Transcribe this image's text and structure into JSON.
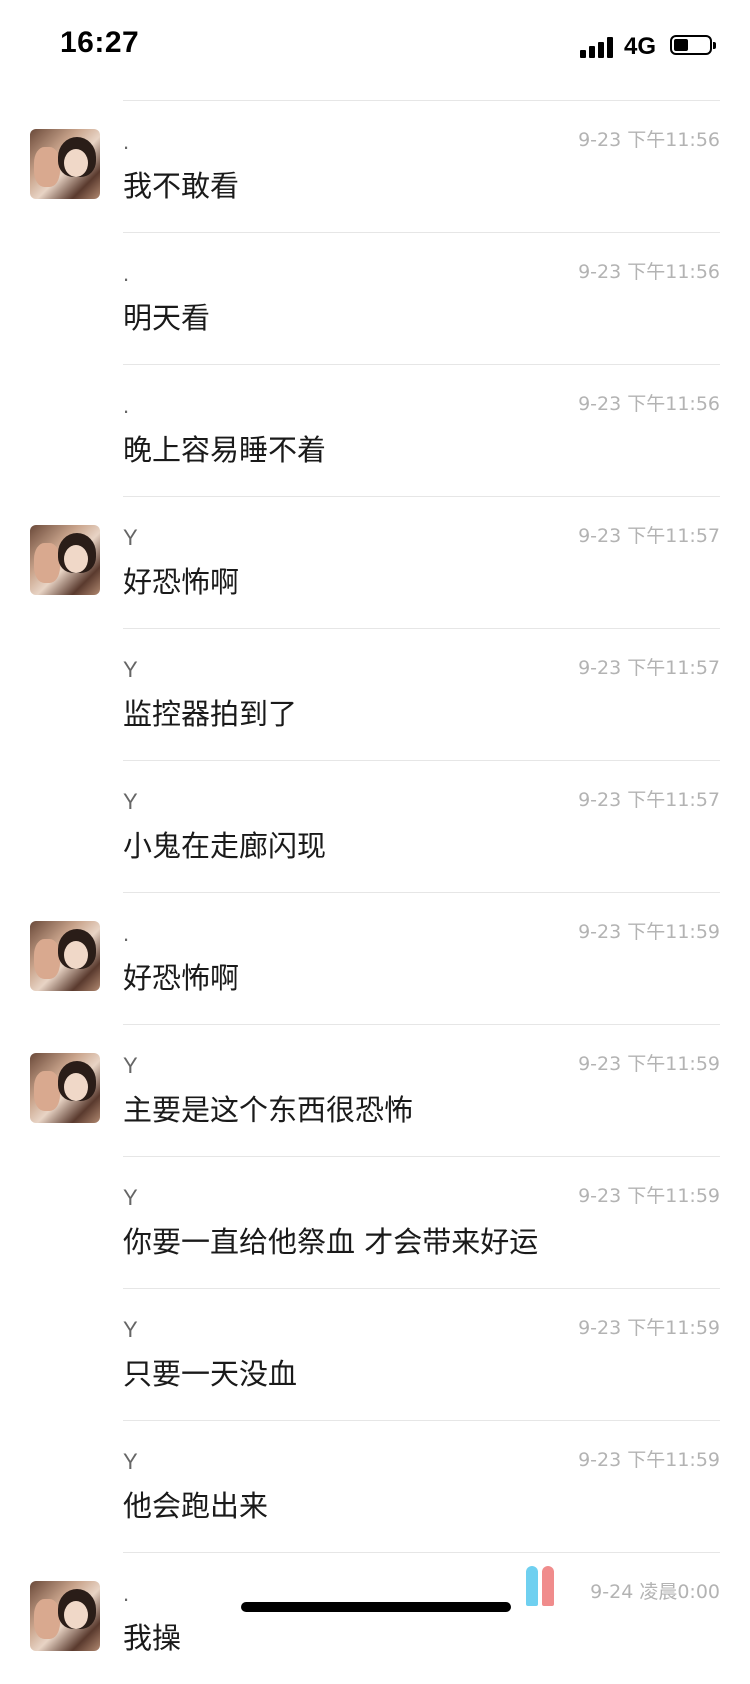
{
  "status_bar": {
    "time": "16:27",
    "network": "4G",
    "signal_bars": 4,
    "battery_level": 0.4
  },
  "messages": [
    {
      "show_avatar": true,
      "sender": ".",
      "time": "9-23 下午11:56",
      "text": "我不敢看"
    },
    {
      "show_avatar": false,
      "sender": ".",
      "time": "9-23 下午11:56",
      "text": "明天看"
    },
    {
      "show_avatar": false,
      "sender": ".",
      "time": "9-23 下午11:56",
      "text": "晚上容易睡不着"
    },
    {
      "show_avatar": true,
      "sender": "Y",
      "time": "9-23 下午11:57",
      "text": "好恐怖啊"
    },
    {
      "show_avatar": false,
      "sender": "Y",
      "time": "9-23 下午11:57",
      "text": "监控器拍到了"
    },
    {
      "show_avatar": false,
      "sender": "Y",
      "time": "9-23 下午11:57",
      "text": "小鬼在走廊闪现"
    },
    {
      "show_avatar": true,
      "sender": ".",
      "time": "9-23 下午11:59",
      "text": "好恐怖啊"
    },
    {
      "show_avatar": true,
      "sender": "Y",
      "time": "9-23 下午11:59",
      "text": "主要是这个东西很恐怖"
    },
    {
      "show_avatar": false,
      "sender": "Y",
      "time": "9-23 下午11:59",
      "text": "你要一直给他祭血 才会带来好运"
    },
    {
      "show_avatar": false,
      "sender": "Y",
      "time": "9-23 下午11:59",
      "text": "只要一天没血"
    },
    {
      "show_avatar": false,
      "sender": "Y",
      "time": "9-23 下午11:59",
      "text": "他会跑出来"
    },
    {
      "show_avatar": true,
      "sender": ".",
      "time": "9-24 凌晨0:00",
      "text": "我操"
    }
  ],
  "icons": {
    "signal": "signal-bars-icon",
    "battery": "battery-icon",
    "watermark": "couple-silhouette-icon"
  }
}
